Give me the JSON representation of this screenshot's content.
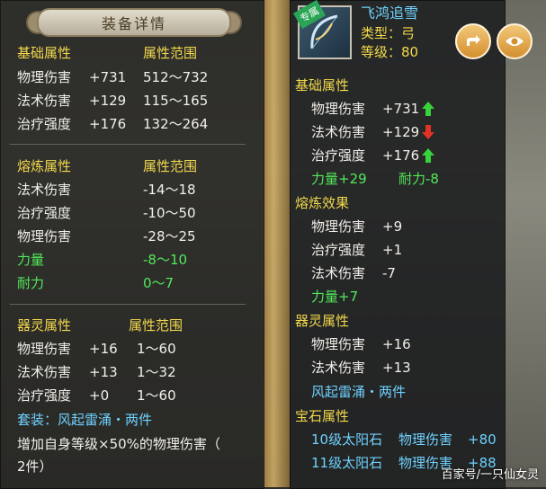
{
  "left": {
    "title": "装备详情",
    "base_header": "基础属性",
    "base_range_header": "属性范围",
    "base_rows": [
      {
        "name": "物理伤害",
        "value": "+731",
        "range": "512～732"
      },
      {
        "name": "法术伤害",
        "value": "+129",
        "range": "115～165"
      },
      {
        "name": "治疗强度",
        "value": "+176",
        "range": "132～264"
      }
    ],
    "refine_header": "熔炼属性",
    "refine_range_header": "属性范围",
    "refine_rows": [
      {
        "name": "法术伤害",
        "range": "-14～18"
      },
      {
        "name": "治疗强度",
        "range": "-10～50"
      },
      {
        "name": "物理伤害",
        "range": "-28～25"
      },
      {
        "name": "力量",
        "range": "-8～10"
      },
      {
        "name": "耐力",
        "range": "0～7"
      }
    ],
    "spirit_header": "器灵属性",
    "spirit_range_header": "属性范围",
    "spirit_rows": [
      {
        "name": "物理伤害",
        "value": "+16",
        "range": "1～60"
      },
      {
        "name": "法术伤害",
        "value": "+13",
        "range": "1～32"
      },
      {
        "name": "治疗强度",
        "value": "+0",
        "range": "1～60"
      }
    ],
    "set_label": "套装：风起雷涌・两件",
    "set_desc_line1": "增加自身等级×50%的物理伤害（",
    "set_desc_line2": "2件）"
  },
  "right": {
    "badge": "专属",
    "item_name": "飞鸿追雪",
    "type": "类型：弓",
    "level": "等级：80",
    "base_header": "基础属性",
    "base_rows": [
      {
        "name": "物理伤害",
        "value": "+731",
        "trend": "up"
      },
      {
        "name": "法术伤害",
        "value": "+129",
        "trend": "down"
      },
      {
        "name": "治疗强度",
        "value": "+176",
        "trend": "up"
      }
    ],
    "extra_1": "力量+29",
    "extra_2": "耐力-8",
    "refine_header": "熔炼效果",
    "refine_rows": [
      {
        "name": "物理伤害",
        "value": "+9"
      },
      {
        "name": "治疗强度",
        "value": "+1"
      },
      {
        "name": "法术伤害",
        "value": "-7"
      }
    ],
    "refine_extra": "力量+7",
    "spirit_header": "器灵属性",
    "spirit_rows": [
      {
        "name": "物理伤害",
        "value": "+16"
      },
      {
        "name": "法术伤害",
        "value": "+13"
      }
    ],
    "spirit_set": "风起雷涌・两件",
    "gem_header": "宝石属性",
    "gem_rows": [
      {
        "gem": "10级太阳石",
        "attr": "物理伤害",
        "value": "+80"
      },
      {
        "gem": "11级太阳石",
        "attr": "物理伤害",
        "value": "+88"
      }
    ]
  },
  "watermark": "百家号/一只仙女灵",
  "colors": {
    "header": "#f2d94c",
    "value": "#f2f0ea",
    "bonus": "#52e85a",
    "set": "#6fd2ff",
    "up": "#37d23c",
    "down": "#e23226"
  }
}
